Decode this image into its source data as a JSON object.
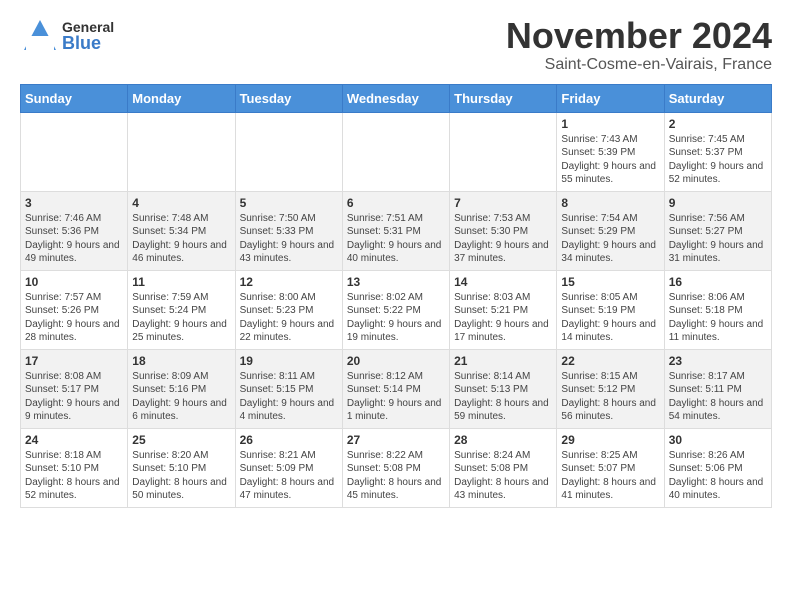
{
  "header": {
    "logo_general": "General",
    "logo_blue": "Blue",
    "month_year": "November 2024",
    "location": "Saint-Cosme-en-Vairais, France"
  },
  "weekdays": [
    "Sunday",
    "Monday",
    "Tuesday",
    "Wednesday",
    "Thursday",
    "Friday",
    "Saturday"
  ],
  "weeks": [
    [
      {
        "day": "",
        "info": ""
      },
      {
        "day": "",
        "info": ""
      },
      {
        "day": "",
        "info": ""
      },
      {
        "day": "",
        "info": ""
      },
      {
        "day": "",
        "info": ""
      },
      {
        "day": "1",
        "info": "Sunrise: 7:43 AM\nSunset: 5:39 PM\nDaylight: 9 hours and 55 minutes."
      },
      {
        "day": "2",
        "info": "Sunrise: 7:45 AM\nSunset: 5:37 PM\nDaylight: 9 hours and 52 minutes."
      }
    ],
    [
      {
        "day": "3",
        "info": "Sunrise: 7:46 AM\nSunset: 5:36 PM\nDaylight: 9 hours and 49 minutes."
      },
      {
        "day": "4",
        "info": "Sunrise: 7:48 AM\nSunset: 5:34 PM\nDaylight: 9 hours and 46 minutes."
      },
      {
        "day": "5",
        "info": "Sunrise: 7:50 AM\nSunset: 5:33 PM\nDaylight: 9 hours and 43 minutes."
      },
      {
        "day": "6",
        "info": "Sunrise: 7:51 AM\nSunset: 5:31 PM\nDaylight: 9 hours and 40 minutes."
      },
      {
        "day": "7",
        "info": "Sunrise: 7:53 AM\nSunset: 5:30 PM\nDaylight: 9 hours and 37 minutes."
      },
      {
        "day": "8",
        "info": "Sunrise: 7:54 AM\nSunset: 5:29 PM\nDaylight: 9 hours and 34 minutes."
      },
      {
        "day": "9",
        "info": "Sunrise: 7:56 AM\nSunset: 5:27 PM\nDaylight: 9 hours and 31 minutes."
      }
    ],
    [
      {
        "day": "10",
        "info": "Sunrise: 7:57 AM\nSunset: 5:26 PM\nDaylight: 9 hours and 28 minutes."
      },
      {
        "day": "11",
        "info": "Sunrise: 7:59 AM\nSunset: 5:24 PM\nDaylight: 9 hours and 25 minutes."
      },
      {
        "day": "12",
        "info": "Sunrise: 8:00 AM\nSunset: 5:23 PM\nDaylight: 9 hours and 22 minutes."
      },
      {
        "day": "13",
        "info": "Sunrise: 8:02 AM\nSunset: 5:22 PM\nDaylight: 9 hours and 19 minutes."
      },
      {
        "day": "14",
        "info": "Sunrise: 8:03 AM\nSunset: 5:21 PM\nDaylight: 9 hours and 17 minutes."
      },
      {
        "day": "15",
        "info": "Sunrise: 8:05 AM\nSunset: 5:19 PM\nDaylight: 9 hours and 14 minutes."
      },
      {
        "day": "16",
        "info": "Sunrise: 8:06 AM\nSunset: 5:18 PM\nDaylight: 9 hours and 11 minutes."
      }
    ],
    [
      {
        "day": "17",
        "info": "Sunrise: 8:08 AM\nSunset: 5:17 PM\nDaylight: 9 hours and 9 minutes."
      },
      {
        "day": "18",
        "info": "Sunrise: 8:09 AM\nSunset: 5:16 PM\nDaylight: 9 hours and 6 minutes."
      },
      {
        "day": "19",
        "info": "Sunrise: 8:11 AM\nSunset: 5:15 PM\nDaylight: 9 hours and 4 minutes."
      },
      {
        "day": "20",
        "info": "Sunrise: 8:12 AM\nSunset: 5:14 PM\nDaylight: 9 hours and 1 minute."
      },
      {
        "day": "21",
        "info": "Sunrise: 8:14 AM\nSunset: 5:13 PM\nDaylight: 8 hours and 59 minutes."
      },
      {
        "day": "22",
        "info": "Sunrise: 8:15 AM\nSunset: 5:12 PM\nDaylight: 8 hours and 56 minutes."
      },
      {
        "day": "23",
        "info": "Sunrise: 8:17 AM\nSunset: 5:11 PM\nDaylight: 8 hours and 54 minutes."
      }
    ],
    [
      {
        "day": "24",
        "info": "Sunrise: 8:18 AM\nSunset: 5:10 PM\nDaylight: 8 hours and 52 minutes."
      },
      {
        "day": "25",
        "info": "Sunrise: 8:20 AM\nSunset: 5:10 PM\nDaylight: 8 hours and 50 minutes."
      },
      {
        "day": "26",
        "info": "Sunrise: 8:21 AM\nSunset: 5:09 PM\nDaylight: 8 hours and 47 minutes."
      },
      {
        "day": "27",
        "info": "Sunrise: 8:22 AM\nSunset: 5:08 PM\nDaylight: 8 hours and 45 minutes."
      },
      {
        "day": "28",
        "info": "Sunrise: 8:24 AM\nSunset: 5:08 PM\nDaylight: 8 hours and 43 minutes."
      },
      {
        "day": "29",
        "info": "Sunrise: 8:25 AM\nSunset: 5:07 PM\nDaylight: 8 hours and 41 minutes."
      },
      {
        "day": "30",
        "info": "Sunrise: 8:26 AM\nSunset: 5:06 PM\nDaylight: 8 hours and 40 minutes."
      }
    ]
  ]
}
